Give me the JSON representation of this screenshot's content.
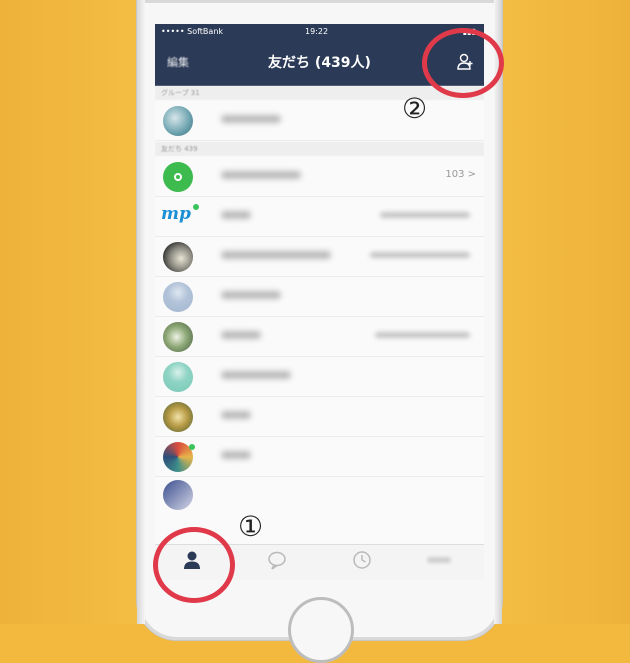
{
  "status_bar": {
    "carrier": "••••• SoftBank",
    "time": "19:22",
    "battery": "▮▮▮"
  },
  "nav": {
    "edit_label": "編集",
    "title": "友だち (439人)"
  },
  "sections": {
    "groups": "グループ 31",
    "friends": "友だち 439"
  },
  "rows": [
    {
      "avatar": "photo-landscape",
      "count": ""
    },
    {
      "avatar": "green-circle",
      "count": "103 >"
    },
    {
      "avatar": "mp-logo",
      "count": ""
    },
    {
      "avatar": "photo-dark",
      "count": ""
    },
    {
      "avatar": "default-blue",
      "count": ""
    },
    {
      "avatar": "photo-plants",
      "count": ""
    },
    {
      "avatar": "default-teal",
      "count": ""
    },
    {
      "avatar": "photo-food",
      "count": ""
    },
    {
      "avatar": "photo-colorful",
      "count": ""
    }
  ],
  "tabs": [
    "friends-icon",
    "chat-icon",
    "timeline-icon",
    "other"
  ],
  "annotations": {
    "one": "①",
    "two": "②"
  },
  "colors": {
    "navbar": "#2b3a57",
    "highlight": "#e03a4a",
    "background": "#f2b93e"
  }
}
